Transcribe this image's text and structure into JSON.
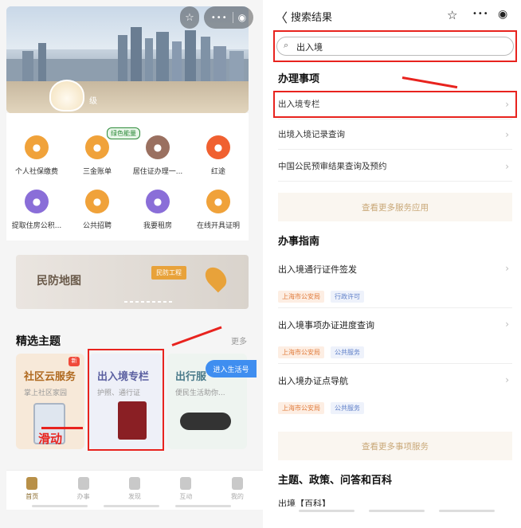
{
  "left": {
    "level_text": "级",
    "pill_icons": [
      "star-icon",
      "more-icon",
      "target-icon"
    ],
    "pill_more": "•••",
    "green_tag": "绿色能量",
    "services": [
      {
        "label": "个人社保缴费",
        "icon": "social-security-icon",
        "color": "#f0a23a"
      },
      {
        "label": "三金账单",
        "icon": "bill-icon",
        "color": "#f0a23a"
      },
      {
        "label": "居住证办理一...",
        "icon": "id-card-icon",
        "color": "#9a7060"
      },
      {
        "label": "红途",
        "icon": "star-badge-icon",
        "color": "#f06030"
      },
      {
        "label": "提取住房公积...",
        "icon": "fund-icon",
        "color": "#8a6ed8"
      },
      {
        "label": "公共招聘",
        "icon": "recruit-icon",
        "color": "#f0a23a"
      },
      {
        "label": "我要租房",
        "icon": "house-icon",
        "color": "#8a6ed8"
      },
      {
        "label": "在线开具证明",
        "icon": "certificate-icon",
        "color": "#f0a23a"
      }
    ],
    "map_banner": {
      "title": "民防地图",
      "tag": "民防工程"
    },
    "featured": {
      "title": "精选主题",
      "more": "更多"
    },
    "theme_cards": [
      {
        "title": "社区云服务",
        "sub": "掌上社区家园",
        "badge": "新"
      },
      {
        "title": "出入境专栏",
        "sub": "护照、通行证"
      },
      {
        "title": "出行服",
        "sub": "便民生活助你..."
      }
    ],
    "join_button": "进入生活号",
    "swipe_label": "滑动",
    "tabs": [
      "首页",
      "办事",
      "发现",
      "互动",
      "我的"
    ]
  },
  "right": {
    "back": "〈",
    "title": "搜索结果",
    "search_value": "出入境",
    "sec_affairs": "办理事项",
    "affairs": [
      "出入境专栏",
      "出境入境记录查询",
      "中国公民预审结果查询及预约"
    ],
    "more_services": "查看更多服务应用",
    "sec_guide": "办事指南",
    "guides": [
      {
        "title": "出入境通行证件签发",
        "org": "上海市公安局",
        "type": "行政许可"
      },
      {
        "title": "出入境事项办证进度查询",
        "org": "上海市公安局",
        "type": "公共服务"
      },
      {
        "title": "出入境办证点导航",
        "org": "上海市公安局",
        "type": "公共服务"
      }
    ],
    "more_guides": "查看更多事项服务",
    "sec_topics": "主题、政策、问答和百科",
    "topic_partial": "出境【百科】"
  }
}
